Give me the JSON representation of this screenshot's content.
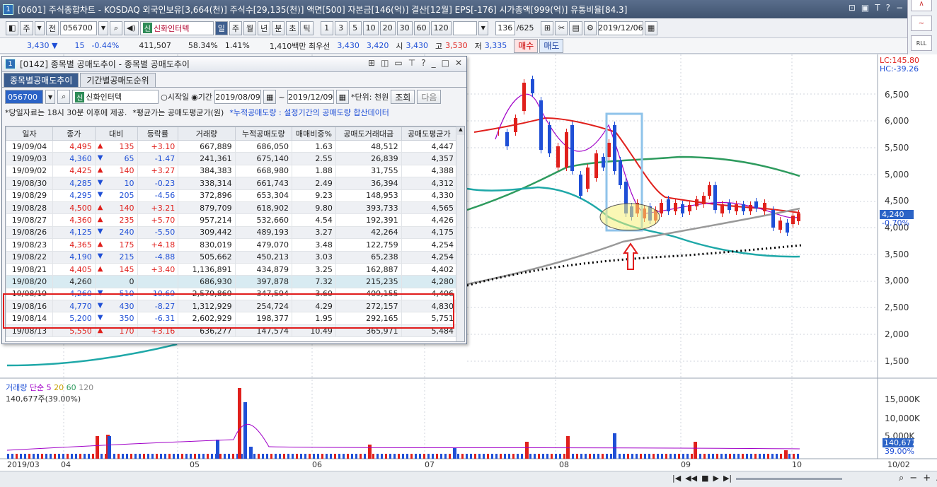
{
  "main_window": {
    "num": "1",
    "title": "[0601] 주식종합차트 - KOSDAQ 외국인보유[3,664(천)] 주식수[29,135(천)] 액면[500] 자본금[146(억)] 결산[12월] EPS[-176] 시가총액[999(억)] 유통비율[84.3]",
    "icons": [
      "⊡",
      "▣",
      "T",
      "?",
      "−"
    ]
  },
  "toolbar": {
    "btn_ju": "주",
    "btn_jeon": "전",
    "code": "056700",
    "stock_tag": "신",
    "stock_name": "신화인터텍",
    "periods": [
      "일",
      "주",
      "월",
      "년",
      "분",
      "초",
      "틱"
    ],
    "active_period": "일",
    "intervals": [
      "1",
      "3",
      "5",
      "10",
      "20",
      "30",
      "60",
      "120"
    ],
    "count": "136",
    "count_total": "/625",
    "date": "2019/12/06"
  },
  "pricebar": {
    "price": "3,430 ▼",
    "change": "15",
    "change_pct": "-0.44%",
    "volume": "411,507",
    "vol_pct": "58.34%",
    "turnover": "1.41%",
    "amount": "1,410백만 최우선",
    "ask": "3,430",
    "bid": "3,420",
    "open_label": "시",
    "open": "3,430",
    "high_label": "고",
    "high": "3,530",
    "low_label": "저",
    "low": "3,335",
    "buy_label": "매수",
    "sell_label": "매도"
  },
  "right_strip": {
    "buttons": [
      "∧",
      "~",
      "RLL"
    ]
  },
  "subwindow": {
    "num": "1",
    "title": "[0142] 종목별 공매도추이 - 종목별 공매도추이",
    "tabs": [
      "종목별공매도추이",
      "기간별공매도순위"
    ],
    "code": "056700",
    "stock_tag": "신",
    "stock_name": "신화인터텍",
    "radio_start": "시작일",
    "radio_period": "기간",
    "from_date": "2019/08/09",
    "tilde": "~",
    "to_date": "2019/12/09",
    "unit": "*단위: 천원",
    "query_btn": "조회",
    "next_btn": "다음",
    "notice1": "*당일자료는 18시 30분 이후에 제공.",
    "notice2": "*평균가는 공매도평균가(원)",
    "notice3": "*누적공매도량 : 설정기간의 공매도량 합산데이터",
    "columns": [
      "일자",
      "종가",
      "대비",
      "등락률",
      "거래량",
      "누적공매도량",
      "매매비중%",
      "공매도거래대금",
      "공매도평균가"
    ],
    "rows": [
      {
        "date": "19/09/04",
        "close": "4,495",
        "dir": "▲",
        "diff": "135",
        "rate": "+3.10",
        "vol": "667,889",
        "cum": "686,050",
        "ratio": "1.63",
        "amt": "48,512",
        "avg": "4,447"
      },
      {
        "date": "19/09/03",
        "close": "4,360",
        "dir": "▼",
        "diff": "65",
        "rate": "-1.47",
        "vol": "241,361",
        "cum": "675,140",
        "ratio": "2.55",
        "amt": "26,839",
        "avg": "4,357"
      },
      {
        "date": "19/09/02",
        "close": "4,425",
        "dir": "▲",
        "diff": "140",
        "rate": "+3.27",
        "vol": "384,383",
        "cum": "668,980",
        "ratio": "1.88",
        "amt": "31,755",
        "avg": "4,388"
      },
      {
        "date": "19/08/30",
        "close": "4,285",
        "dir": "▼",
        "diff": "10",
        "rate": "-0.23",
        "vol": "338,314",
        "cum": "661,743",
        "ratio": "2.49",
        "amt": "36,394",
        "avg": "4,312"
      },
      {
        "date": "19/08/29",
        "close": "4,295",
        "dir": "▼",
        "diff": "205",
        "rate": "-4.56",
        "vol": "372,896",
        "cum": "653,304",
        "ratio": "9.23",
        "amt": "148,953",
        "avg": "4,330"
      },
      {
        "date": "19/08/28",
        "close": "4,500",
        "dir": "▲",
        "diff": "140",
        "rate": "+3.21",
        "vol": "879,709",
        "cum": "618,902",
        "ratio": "9.80",
        "amt": "393,733",
        "avg": "4,565"
      },
      {
        "date": "19/08/27",
        "close": "4,360",
        "dir": "▲",
        "diff": "235",
        "rate": "+5.70",
        "vol": "957,214",
        "cum": "532,660",
        "ratio": "4.54",
        "amt": "192,391",
        "avg": "4,426"
      },
      {
        "date": "19/08/26",
        "close": "4,125",
        "dir": "▼",
        "diff": "240",
        "rate": "-5.50",
        "vol": "309,442",
        "cum": "489,193",
        "ratio": "3.27",
        "amt": "42,264",
        "avg": "4,175"
      },
      {
        "date": "19/08/23",
        "close": "4,365",
        "dir": "▲",
        "diff": "175",
        "rate": "+4.18",
        "vol": "830,019",
        "cum": "479,070",
        "ratio": "3.48",
        "amt": "122,759",
        "avg": "4,254"
      },
      {
        "date": "19/08/22",
        "close": "4,190",
        "dir": "▼",
        "diff": "215",
        "rate": "-4.88",
        "vol": "505,662",
        "cum": "450,213",
        "ratio": "3.03",
        "amt": "65,238",
        "avg": "4,254"
      },
      {
        "date": "19/08/21",
        "close": "4,405",
        "dir": "▲",
        "diff": "145",
        "rate": "+3.40",
        "vol": "1,136,891",
        "cum": "434,879",
        "ratio": "3.25",
        "amt": "162,887",
        "avg": "4,402"
      },
      {
        "date": "19/08/20",
        "close": "4,260",
        "dir": "",
        "diff": "0",
        "rate": "",
        "vol": "686,930",
        "cum": "397,878",
        "ratio": "7.32",
        "amt": "215,235",
        "avg": "4,280"
      },
      {
        "date": "19/08/19",
        "close": "4,260",
        "dir": "▼",
        "diff": "510",
        "rate": "-10.69",
        "vol": "2,579,869",
        "cum": "347,594",
        "ratio": "3.60",
        "amt": "409,155",
        "avg": "4,406"
      },
      {
        "date": "19/08/16",
        "close": "4,770",
        "dir": "▼",
        "diff": "430",
        "rate": "-8.27",
        "vol": "1,312,929",
        "cum": "254,724",
        "ratio": "4.29",
        "amt": "272,157",
        "avg": "4,830"
      },
      {
        "date": "19/08/14",
        "close": "5,200",
        "dir": "▼",
        "diff": "350",
        "rate": "-6.31",
        "vol": "2,602,929",
        "cum": "198,377",
        "ratio": "1.95",
        "amt": "292,165",
        "avg": "5,751"
      },
      {
        "date": "19/08/13",
        "close": "5,550",
        "dir": "▲",
        "diff": "170",
        "rate": "+3.16",
        "vol": "636,277",
        "cum": "147,574",
        "ratio": "10.49",
        "amt": "365,971",
        "avg": "5,484"
      }
    ]
  },
  "price_chart": {
    "lc": "LC:145.80",
    "hc": "HC:-39.26",
    "y_ticks": [
      "6,500",
      "6,000",
      "5,500",
      "5,000",
      "4,500",
      "4,000",
      "3,500",
      "3,000",
      "2,500",
      "2,000",
      "1,500"
    ],
    "current_price": "4,240",
    "current_pct": "-0.70%"
  },
  "volume_chart": {
    "legend_label": "거래량",
    "ma_label": "단순",
    "ma5": "5",
    "ma20": "20",
    "ma60": "60",
    "ma120": "120",
    "last": "140,677주(39.00%)",
    "y_ticks": [
      "15,000K",
      "10,000K",
      "5,000K"
    ],
    "current": "140,677",
    "current_pct": "39.00%"
  },
  "x_ticks": [
    "2019/03",
    "04",
    "05",
    "06",
    "07",
    "08",
    "09",
    "10",
    "10/02"
  ],
  "colors": {
    "up": "#e0201c",
    "down": "#1f4fd6",
    "ma5": "#a000c8",
    "ma20": "#e0201c",
    "ma60": "#1fa8a8",
    "ma120": "#2e9b5e",
    "ma_long": "#999999"
  }
}
